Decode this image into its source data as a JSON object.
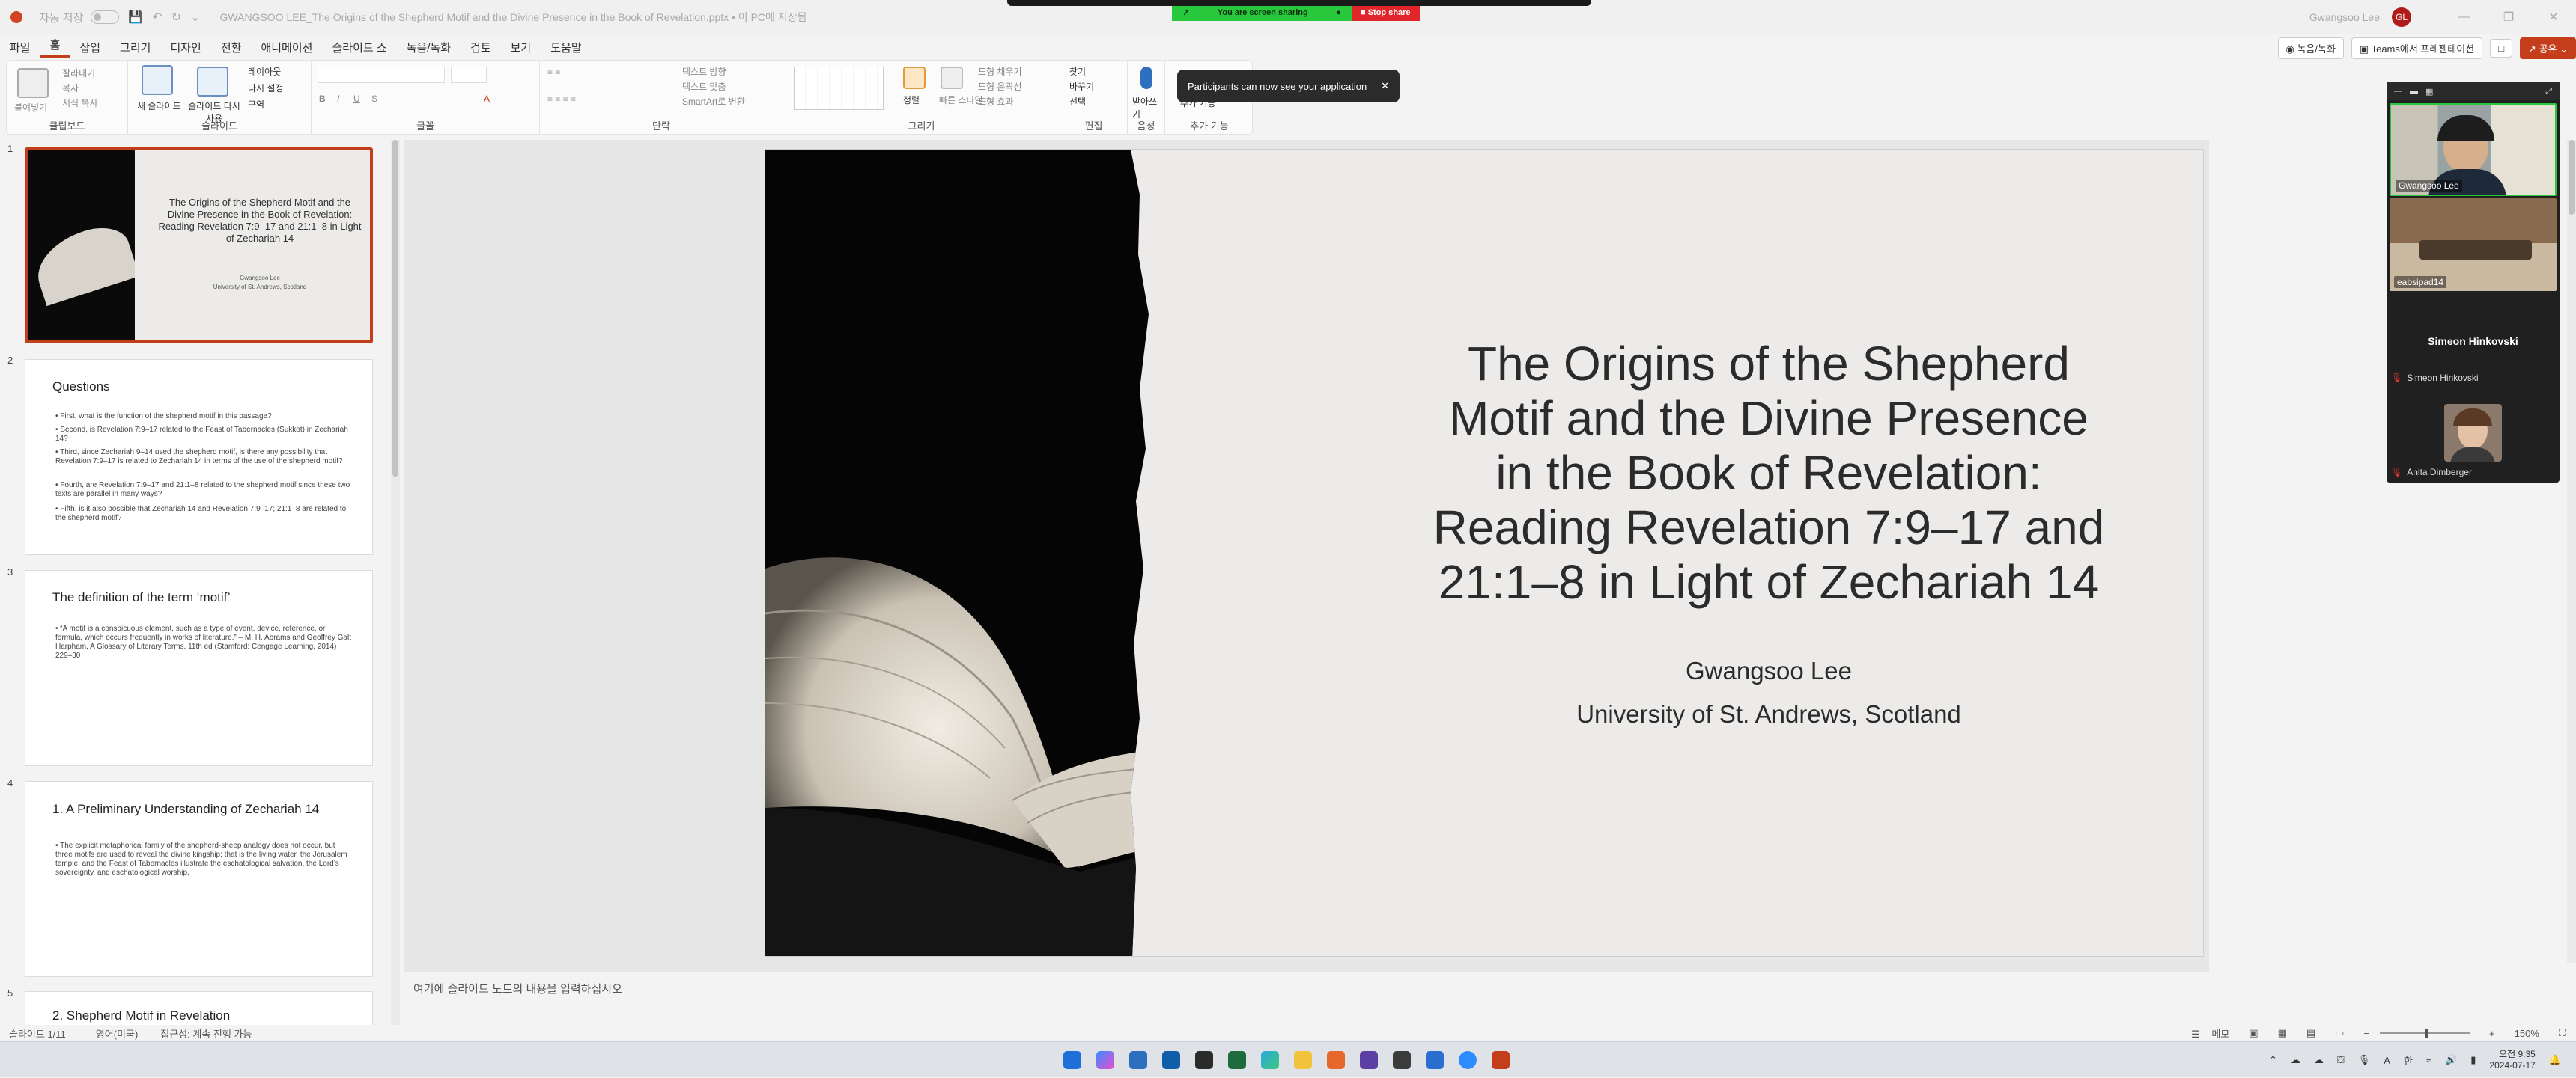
{
  "titlebar": {
    "autosave": "자동 저장",
    "document": "GWANGSOO LEE_The Origins of the Shepherd Motif and the Divine Presence in the Book of Revelation.pptx • 이 PC에 저장됨",
    "user": "Gwangsoo Lee",
    "user_initials": "GL"
  },
  "sharing": {
    "status": "You are screen sharing",
    "stop": "Stop share"
  },
  "toast": {
    "message": "Participants can now see your application"
  },
  "menu": {
    "items": [
      "파일",
      "홈",
      "삽입",
      "그리기",
      "디자인",
      "전환",
      "애니메이션",
      "슬라이드 쇼",
      "녹음/녹화",
      "검토",
      "보기",
      "도움말"
    ],
    "active": "홈"
  },
  "menu_right": {
    "record": "녹음/녹화",
    "teams": "Teams에서 프레젠테이션",
    "share": "공유"
  },
  "ribbon": {
    "groups": [
      "클립보드",
      "슬라이드",
      "글꼴",
      "단락",
      "그리기",
      "편집",
      "음성",
      "추가 기능"
    ],
    "clipboard": [
      "붙여넣기",
      "잘라내기",
      "복사",
      "서식 복사"
    ],
    "slides": [
      "새 슬라이드",
      "슬라이드 다시 사용",
      "레이아웃",
      "다시 설정",
      "구역"
    ],
    "paragraph": [
      "텍스트 방향",
      "텍스트 맞춤",
      "SmartArt로 변환"
    ],
    "drawing": [
      "정렬",
      "빠른 스타일",
      "도형 채우기",
      "도형 윤곽선",
      "도형 효과"
    ],
    "editing": [
      "찾기",
      "바꾸기",
      "선택"
    ],
    "voice": [
      "받아쓰기"
    ],
    "addins": [
      "추가 기능"
    ]
  },
  "slides": [
    {
      "num": "1",
      "title": "The Origins of the Shepherd Motif and the Divine Presence in the Book of Revelation: Reading Revelation 7:9–17 and 21:1–8 in Light of Zechariah 14",
      "author": "Gwangsoo Lee",
      "affiliation": "University of St. Andrews, Scotland"
    },
    {
      "num": "2",
      "title": "Questions",
      "bullets": [
        "First, what is the function of the shepherd motif in this passage?",
        "Second, is Revelation 7:9–17 related to the Feast of Tabernacles (Sukkot) in Zechariah 14?",
        "Third, since Zechariah 9–14 used the shepherd motif, is there any possibility that Revelation 7:9–17 is related to Zechariah 14 in terms of the use of the shepherd motif?",
        "Fourth, are Revelation 7:9–17 and 21:1–8 related to the shepherd motif since these two texts are parallel in many ways?",
        "Fifth, is it also possible that Zechariah 14 and Revelation 7:9–17; 21:1–8 are related to the shepherd motif?"
      ]
    },
    {
      "num": "3",
      "title": "The definition of the term ‘motif’",
      "bullets": [
        "“A motif is a conspicuous element, such as a type of event, device, reference, or formula, which occurs frequently in works of literature.” – M. H. Abrams and Geoffrey Galt Harpham, A Glossary of Literary Terms, 11th ed (Stamford: Cengage Learning, 2014) 229–30"
      ]
    },
    {
      "num": "4",
      "title": "1. A Preliminary Understanding of Zechariah 14",
      "bullets": [
        "The explicit metaphorical family of the shepherd-sheep analogy does not occur, but three motifs are used to reveal the divine kingship; that is the living water, the Jerusalem temple, and the Feast of Tabernacles illustrate the eschatological salvation, the Lord’s sovereignty, and eschatological worship."
      ]
    },
    {
      "num": "5",
      "title": "2. Shepherd Motif in Revelation"
    }
  ],
  "main_slide": {
    "title_lines": [
      "The Origins of the Shepherd",
      "Motif and the Divine Presence",
      "in the Book of Revelation:",
      "Reading Revelation 7:9–17 and",
      "21:1–8 in Light of Zechariah 14"
    ],
    "author": "Gwangsoo Lee",
    "affiliation": "University of St. Andrews, Scotland"
  },
  "notes": {
    "placeholder": "여기에 슬라이드 노트의 내용을 입력하십시오"
  },
  "teams": {
    "participants": [
      {
        "name": "Gwangsoo Lee"
      },
      {
        "name": "eabsipad14"
      },
      {
        "name": "Simeon Hinkovski",
        "label": "Simeon Hinkovski"
      },
      {
        "name": "Anita Dimberger"
      }
    ]
  },
  "status": {
    "slide": "슬라이드 1/11",
    "language": "영어(미국)",
    "accessibility": "접근성: 계속 진행 가능",
    "notes": "메모",
    "zoom": "150%"
  },
  "clock": {
    "time": "오전 9:35",
    "date": "2024-07-17"
  },
  "tray": {
    "ime": "한",
    "a": "A"
  },
  "colors": {
    "accent": "#c43e1c",
    "share_green": "#27c83b",
    "stop_red": "#e0262b"
  }
}
